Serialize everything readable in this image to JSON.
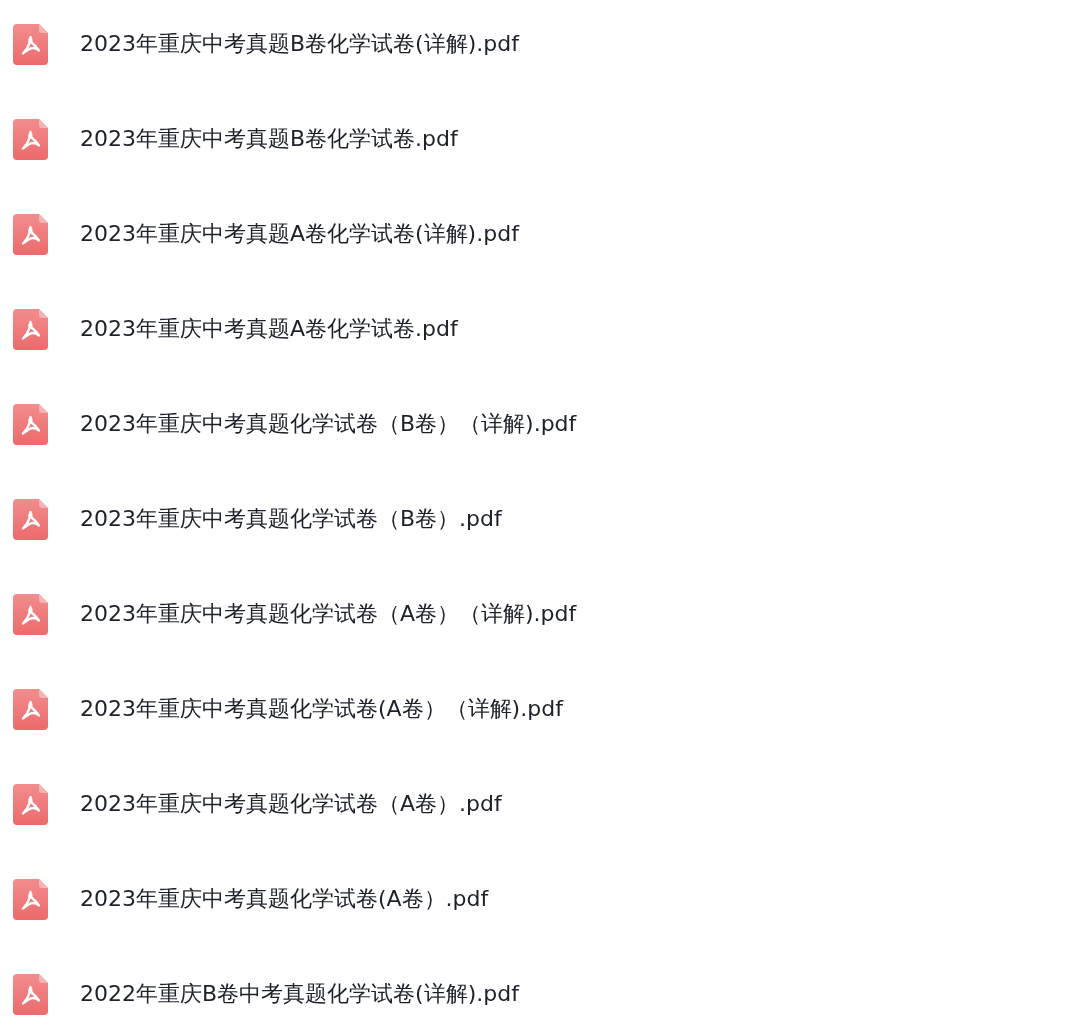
{
  "files": [
    {
      "name": "2023年重庆中考真题B卷化学试卷(详解).pdf"
    },
    {
      "name": "2023年重庆中考真题B卷化学试卷.pdf"
    },
    {
      "name": "2023年重庆中考真题A卷化学试卷(详解).pdf"
    },
    {
      "name": "2023年重庆中考真题A卷化学试卷.pdf"
    },
    {
      "name": "2023年重庆中考真题化学试卷（B卷）（详解).pdf"
    },
    {
      "name": "2023年重庆中考真题化学试卷（B卷）.pdf"
    },
    {
      "name": "2023年重庆中考真题化学试卷（A卷）（详解).pdf"
    },
    {
      "name": "2023年重庆中考真题化学试卷(A卷）（详解).pdf"
    },
    {
      "name": "2023年重庆中考真题化学试卷（A卷）.pdf"
    },
    {
      "name": "2023年重庆中考真题化学试卷(A卷）.pdf"
    },
    {
      "name": "2022年重庆B卷中考真题化学试卷(详解).pdf"
    }
  ]
}
